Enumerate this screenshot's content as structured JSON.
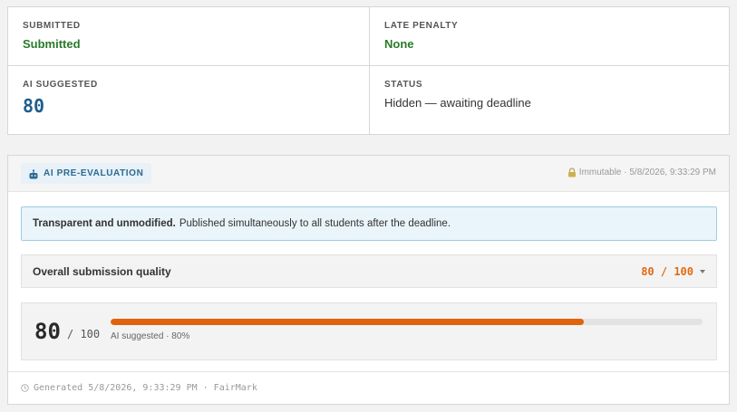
{
  "summary": {
    "submitted": {
      "label": "SUBMITTED",
      "value": "Submitted"
    },
    "late_penalty": {
      "label": "LATE PENALTY",
      "value": "None"
    },
    "ai_suggested": {
      "label": "AI SUGGESTED",
      "value": "80"
    },
    "status": {
      "label": "STATUS",
      "value": "Hidden — awaiting deadline"
    }
  },
  "evaluation": {
    "badge": {
      "icon": "robot-icon",
      "label": "AI PRE-EVALUATION"
    },
    "immutable": {
      "icon": "lock-icon",
      "text": "Immutable · 5/8/2026, 9:33:29 PM"
    },
    "notice": {
      "strong": "Transparent and unmodified.",
      "text": "Published simultaneously to all students after the deadline."
    },
    "criterion": {
      "label": "Overall submission quality",
      "score_display": "80 / 100",
      "expand_icon": "chevron-down-icon"
    },
    "score": {
      "value": "80",
      "out_of": "/ 100",
      "progress": 0.8,
      "caption": "AI suggested · 80%"
    },
    "footer": {
      "icon": "clock-icon",
      "text": "Generated 5/8/2026, 9:33:29 PM · FairMark"
    }
  },
  "colors": {
    "success": "#2a7a2a",
    "ai_score": "#1f5e8c",
    "accent": "#e0620d",
    "notice_bg": "#e9f4fb",
    "notice_border": "#9fcde4"
  }
}
